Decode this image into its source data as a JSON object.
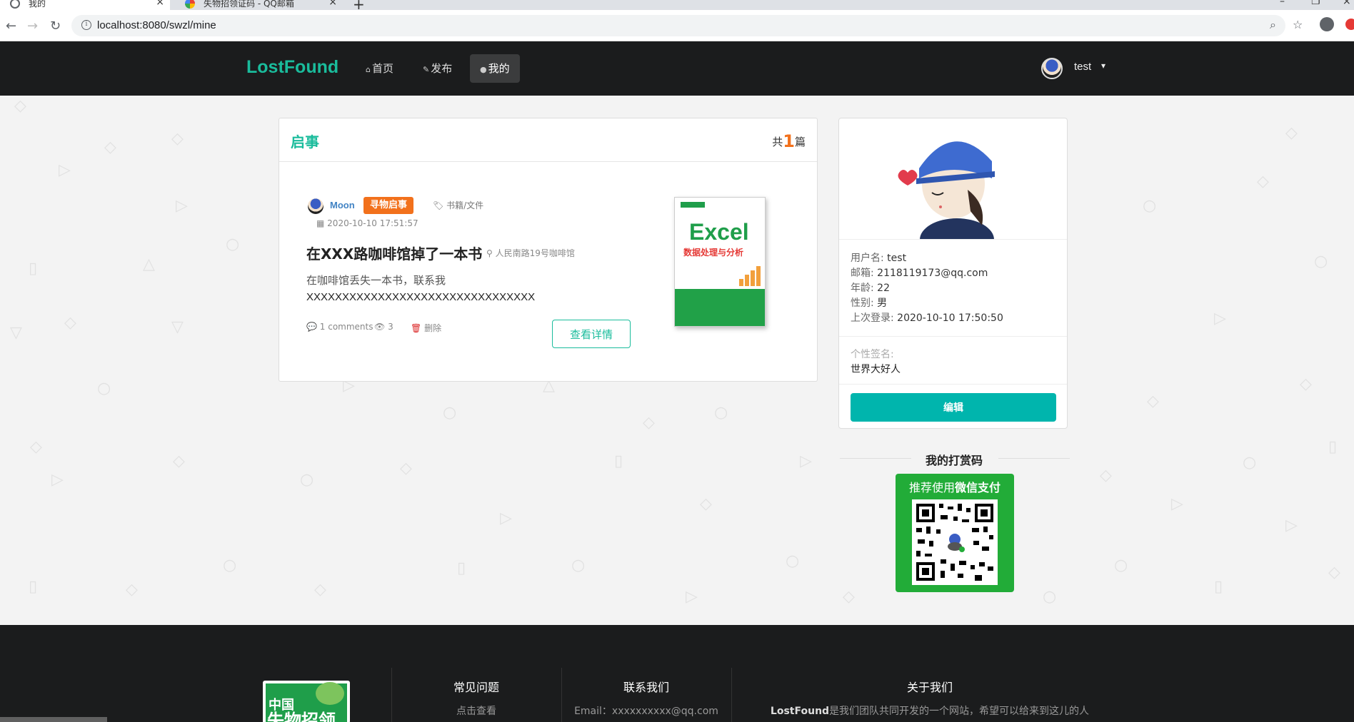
{
  "browser": {
    "tabs": [
      {
        "title": "我的"
      },
      {
        "title": "失物招领证码 - QQ邮箱"
      }
    ],
    "url": "localhost:8080/swzl/mine"
  },
  "navbar": {
    "brand": "LostFound",
    "items": [
      {
        "label": "首页"
      },
      {
        "label": "发布"
      },
      {
        "label": "我的"
      }
    ],
    "username": "test"
  },
  "posts_card": {
    "title": "启事",
    "count_prefix": "共",
    "count": "1",
    "count_suffix": "篇",
    "post": {
      "author": "Moon",
      "badge": "寻物启事",
      "category": "书籍/文件",
      "date": "2020-10-10 17:51:57",
      "title": "在XXX路咖啡馆掉了一本书",
      "location": "人民南路19号咖啡馆",
      "desc_line1": "在咖啡馆丢失一本书，联系我",
      "desc_line2": "XXXXXXXXXXXXXXXXXXXXXXXXXXXXXXXX",
      "comments": "1 comments",
      "views": "3",
      "delete_label": "删除",
      "detail_button": "查看详情",
      "image": {
        "word": "Excel",
        "subtitle": "数据处理与分析"
      }
    }
  },
  "profile": {
    "username_label": "用户名:",
    "username": "test",
    "email_label": "邮箱:",
    "email": "2118119173@qq.com",
    "age_label": "年龄:",
    "age": "22",
    "gender_label": "性别:",
    "gender": "男",
    "last_login_label": "上次登录:",
    "last_login": "2020-10-10 17:50:50",
    "signature_label": "个性签名:",
    "signature": "世界大好人",
    "edit_button": "编辑"
  },
  "reward": {
    "title": "我的打赏码",
    "qr_header_prefix": "推荐使用",
    "qr_header_bold": "微信支付"
  },
  "footer": {
    "logo_line1": "中国",
    "logo_line2": "失物招领",
    "faq_title": "常见问题",
    "faq_link": "点击查看",
    "contact_title": "联系我们",
    "contact_email": "Email：xxxxxxxxxx@qq.com",
    "about_title": "关于我们",
    "about_brand": "LostFound",
    "about_text": "是我们团队共同开发的一个网站，希望可以给来到这儿的人"
  },
  "colors": {
    "brand": "#1abc9c",
    "badge": "#f2711c",
    "edit_button": "#00b5ad",
    "navbar": "#1b1c1d",
    "wechat_green": "#22ac38"
  },
  "icons": [
    "home-icon",
    "edit-icon",
    "user-icon",
    "tag-icon",
    "calendar-icon",
    "map-pin-icon",
    "comment-icon",
    "eye-icon",
    "trash-icon"
  ]
}
